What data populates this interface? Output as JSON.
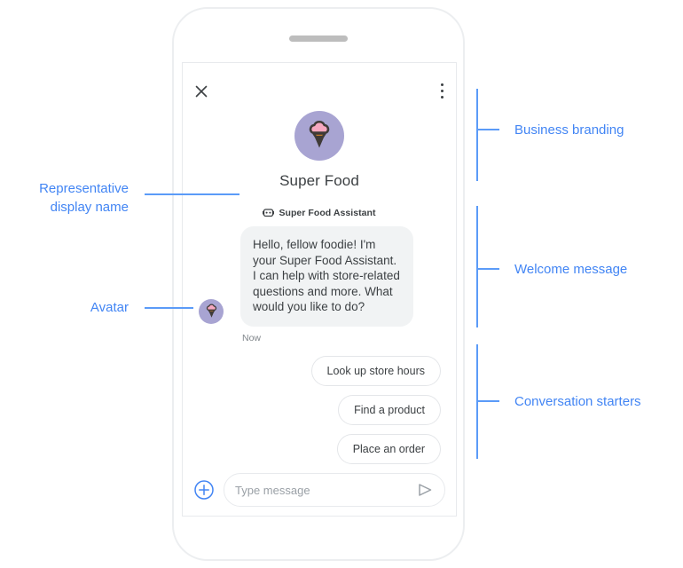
{
  "device": {
    "speaker_icon": "speaker-bar"
  },
  "chat": {
    "close_icon": "close-icon",
    "menu_icon": "more-vert-icon",
    "branding": {
      "logo_icon": "ice-cream-logo-icon",
      "business_name": "Super Food",
      "logo_circle_color": "#a8a4d2",
      "scoop_color": "#f6a8c0",
      "cone_color": "#c07a2c",
      "outline_color": "#3f3b38"
    },
    "representative": {
      "badge_icon": "bot-badge-icon",
      "display_name": "Super Food Assistant"
    },
    "message": {
      "avatar_icon": "ice-cream-avatar-icon",
      "text": "Hello, fellow foodie! I'm your Super Food Assistant. I can help with store-related questions and more. What would you like to do?",
      "timestamp": "Now",
      "bubble_color": "#f1f3f4"
    },
    "conversation_starters": [
      {
        "label": "Look up store hours"
      },
      {
        "label": "Find a product"
      },
      {
        "label": "Place an order"
      }
    ],
    "composer": {
      "add_icon": "plus-circle-icon",
      "placeholder": "Type message",
      "input_value": "",
      "send_icon": "send-icon"
    }
  },
  "annotations": {
    "accent_color": "#4285f4",
    "left": [
      {
        "label": "Representative\ndisplay name"
      },
      {
        "label": "Avatar"
      }
    ],
    "right": [
      {
        "label": "Business branding"
      },
      {
        "label": "Welcome message"
      },
      {
        "label": "Conversation starters"
      }
    ]
  }
}
